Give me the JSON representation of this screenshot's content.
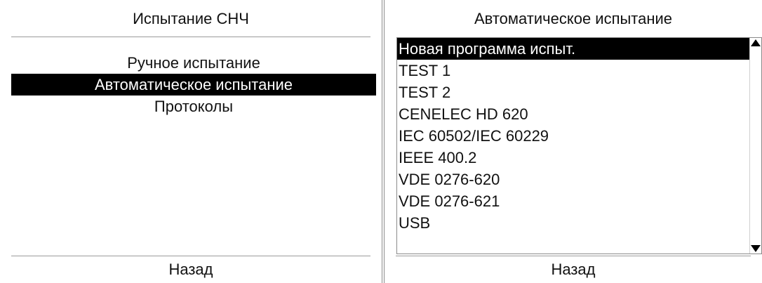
{
  "left_panel": {
    "title": "Испытание СНЧ",
    "menu": [
      {
        "label": "Ручное испытание",
        "selected": false
      },
      {
        "label": "Автоматическое испытание",
        "selected": true
      },
      {
        "label": "Протоколы",
        "selected": false
      }
    ],
    "back_label": "Назад"
  },
  "right_panel": {
    "title": "Автоматическое испытание",
    "programs": [
      {
        "label": "Новая программа испыт.",
        "selected": true
      },
      {
        "label": "TEST 1",
        "selected": false
      },
      {
        "label": "TEST 2",
        "selected": false
      },
      {
        "label": "CENELEC HD 620",
        "selected": false
      },
      {
        "label": "IEC 60502/IEC 60229",
        "selected": false
      },
      {
        "label": "IEEE 400.2",
        "selected": false
      },
      {
        "label": "VDE 0276-620",
        "selected": false
      },
      {
        "label": "VDE 0276-621",
        "selected": false
      },
      {
        "label": "USB",
        "selected": false
      }
    ],
    "back_label": "Назад"
  },
  "icons": {
    "scroll_up": "triangle-up",
    "scroll_down": "triangle-down"
  },
  "colors": {
    "selection_bg": "#000000",
    "selection_fg": "#ffffff",
    "divider": "#9a9a9a"
  }
}
